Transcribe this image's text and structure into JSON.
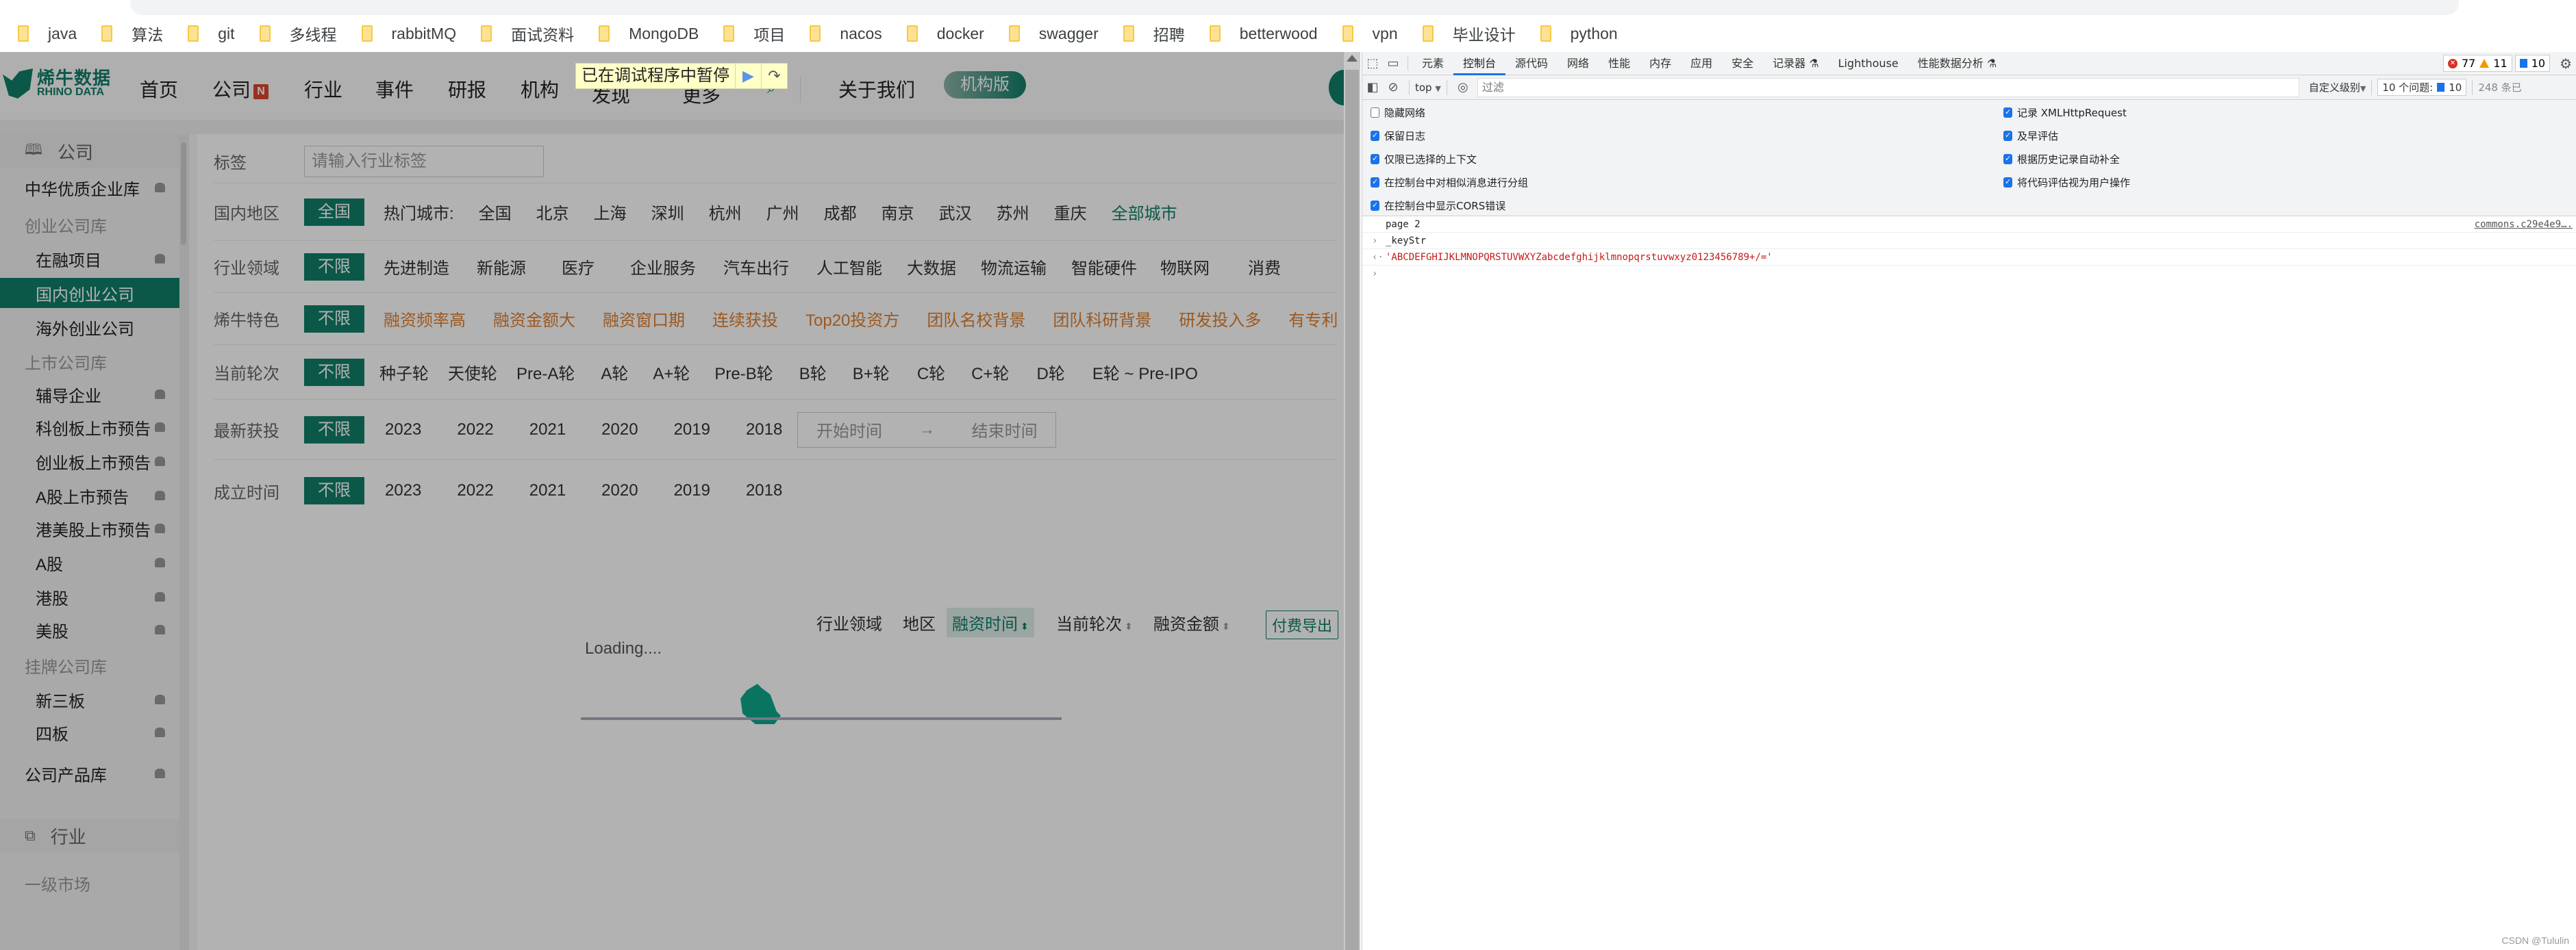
{
  "bookmarks": [
    "java",
    "算法",
    "git",
    "多线程",
    "rabbitMQ",
    "面试资料",
    "MongoDB",
    "项目",
    "nacos",
    "docker",
    "swagger",
    "招聘",
    "betterwood",
    "vpn",
    "毕业设计",
    "python"
  ],
  "site": {
    "logo_cn": "烯牛数据",
    "logo_en": "RHINO DATA",
    "nav": {
      "home": "首页",
      "company": "公司",
      "company_badge": "N",
      "industry": "行业",
      "events": "事件",
      "reports": "研报",
      "institutions": "机构",
      "discover": "发现",
      "more": "更多",
      "about": "关于我们",
      "org_edition": "机构版"
    },
    "debug_banner": "已在调试程序中暂停"
  },
  "sidebar": {
    "sections": [
      {
        "label": "公司",
        "icon": "map-icon"
      },
      {
        "label": "行业",
        "icon": "copy-icon"
      }
    ],
    "items": [
      {
        "label": "中华优质企业库",
        "type": "lvl1",
        "locked": true
      },
      {
        "label": "创业公司库",
        "type": "group",
        "locked": false
      },
      {
        "label": "在融项目",
        "type": "lvl2",
        "locked": true
      },
      {
        "label": "国内创业公司",
        "type": "lvl2",
        "locked": false,
        "active": true
      },
      {
        "label": "海外创业公司",
        "type": "lvl2",
        "locked": false
      },
      {
        "label": "上市公司库",
        "type": "group",
        "locked": false
      },
      {
        "label": "辅导企业",
        "type": "lvl2",
        "locked": true
      },
      {
        "label": "科创板上市预告",
        "type": "lvl2",
        "locked": true
      },
      {
        "label": "创业板上市预告",
        "type": "lvl2",
        "locked": true
      },
      {
        "label": "A股上市预告",
        "type": "lvl2",
        "locked": true
      },
      {
        "label": "港美股上市预告",
        "type": "lvl2",
        "locked": true
      },
      {
        "label": "A股",
        "type": "lvl2",
        "locked": true
      },
      {
        "label": "港股",
        "type": "lvl2",
        "locked": true
      },
      {
        "label": "美股",
        "type": "lvl2",
        "locked": true
      },
      {
        "label": "挂牌公司库",
        "type": "group",
        "locked": false
      },
      {
        "label": "新三板",
        "type": "lvl2",
        "locked": true
      },
      {
        "label": "四板",
        "type": "lvl2",
        "locked": true
      },
      {
        "label": "公司产品库",
        "type": "lvl1",
        "locked": true
      }
    ],
    "market_group": "一级市场"
  },
  "filters": {
    "tag": {
      "label": "标签",
      "placeholder": "请输入行业标签"
    },
    "region": {
      "label": "国内地区",
      "selected": "全国",
      "hot_label": "热门城市:",
      "options": [
        "全国",
        "北京",
        "上海",
        "深圳",
        "杭州",
        "广州",
        "成都",
        "南京",
        "武汉",
        "苏州",
        "重庆"
      ],
      "all_link": "全部城市"
    },
    "industry": {
      "label": "行业领域",
      "selected": "不限",
      "options": [
        "先进制造",
        "新能源",
        "医疗",
        "企业服务",
        "汽车出行",
        "人工智能",
        "大数据",
        "物流运输",
        "智能硬件",
        "物联网",
        "消费"
      ]
    },
    "feature": {
      "label": "烯牛特色",
      "selected": "不限",
      "options": [
        "融资频率高",
        "融资金额大",
        "融资窗口期",
        "连续获投",
        "Top20投资方",
        "团队名校背景",
        "团队科研背景",
        "研发投入多",
        "有专利"
      ]
    },
    "round": {
      "label": "当前轮次",
      "selected": "不限",
      "options": [
        "种子轮",
        "天使轮",
        "Pre-A轮",
        "A轮",
        "A+轮",
        "Pre-B轮",
        "B轮",
        "B+轮",
        "C轮",
        "C+轮",
        "D轮",
        "E轮 ~ Pre-IPO"
      ]
    },
    "latest": {
      "label": "最新获投",
      "selected": "不限",
      "options": [
        "2023",
        "2022",
        "2021",
        "2020",
        "2019",
        "2018"
      ],
      "start_placeholder": "开始时间",
      "arrow": "→",
      "end_placeholder": "结束时间"
    },
    "founded": {
      "label": "成立时间",
      "selected": "不限",
      "options": [
        "2023",
        "2022",
        "2021",
        "2020",
        "2019",
        "2018"
      ]
    }
  },
  "sortbar": {
    "items": [
      "行业领域",
      "地区",
      "融资时间",
      "当前轮次",
      "融资金额"
    ],
    "active": "融资时间",
    "export": "付费导出"
  },
  "loading_text": "Loading....",
  "devtools": {
    "tabs": [
      "元素",
      "控制台",
      "源代码",
      "网络",
      "性能",
      "内存",
      "应用",
      "安全",
      "记录器",
      "Lighthouse",
      "性能数据分析"
    ],
    "active_tab": "控制台",
    "errors": "77",
    "warnings": "11",
    "infos": "10",
    "context": "top",
    "filter_placeholder": "过滤",
    "level": "自定义级别",
    "issues_label": "10 个问题:",
    "issues_count": "10",
    "hidden": "248 条已",
    "settings_left": [
      {
        "label": "隐藏网络",
        "checked": false
      },
      {
        "label": "保留日志",
        "checked": true
      },
      {
        "label": "仅限已选择的上下文",
        "checked": true
      },
      {
        "label": "在控制台中对相似消息进行分组",
        "checked": true
      },
      {
        "label": "在控制台中显示CORS错误",
        "checked": true
      }
    ],
    "settings_right": [
      {
        "label": "记录 XMLHttpRequest",
        "checked": true
      },
      {
        "label": "及早评估",
        "checked": true
      },
      {
        "label": "根据历史记录自动补全",
        "checked": true
      },
      {
        "label": "将代码评估视为用户操作",
        "checked": true
      }
    ],
    "console": {
      "log1": "page 2",
      "log1_source": "commons.c29e4e9….",
      "input": "_keyStr",
      "output": "'ABCDEFGHIJKLMNOPQRSTUVWXYZabcdefghijklmnopqrstuvwxyz0123456789+/='"
    }
  },
  "watermark": "CSDN @Tululin"
}
